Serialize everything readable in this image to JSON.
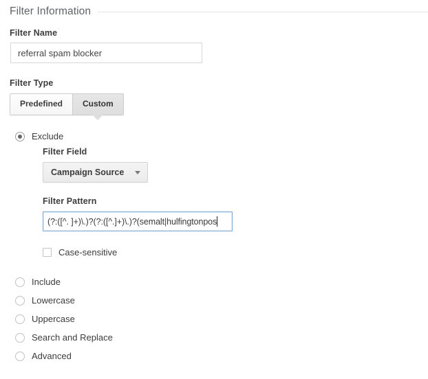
{
  "section": {
    "title": "Filter Information"
  },
  "filter_name": {
    "label": "Filter Name",
    "value": "referral spam blocker",
    "placeholder": ""
  },
  "filter_type": {
    "label": "Filter Type",
    "tabs": [
      {
        "label": "Predefined",
        "selected": false
      },
      {
        "label": "Custom",
        "selected": true
      }
    ]
  },
  "options": [
    {
      "name": "exclude",
      "label": "Exclude",
      "selected": true
    },
    {
      "name": "include",
      "label": "Include",
      "selected": false
    },
    {
      "name": "lowercase",
      "label": "Lowercase",
      "selected": false
    },
    {
      "name": "uppercase",
      "label": "Uppercase",
      "selected": false
    },
    {
      "name": "search-and-replace",
      "label": "Search and Replace",
      "selected": false
    },
    {
      "name": "advanced",
      "label": "Advanced",
      "selected": false
    }
  ],
  "filter_field": {
    "label": "Filter Field",
    "selected": "Campaign Source",
    "chevron_icon": "chevron-down-icon"
  },
  "filter_pattern": {
    "label": "Filter Pattern",
    "value": "(?:([^. ]+)\\.)?(?:([^.]+)\\.)?(semalt|hulfingtonpos",
    "placeholder": ""
  },
  "case_sensitive": {
    "label": "Case-sensitive",
    "checked": false
  },
  "colors": {
    "text": "#3c3c3c",
    "header_text": "#5f6368",
    "rule": "#e3e3e3",
    "input_border": "#d6d6d6",
    "focus_border": "#7ba7d7",
    "tab_selected_bg": "#dedede",
    "radio_dot": "#666666"
  }
}
